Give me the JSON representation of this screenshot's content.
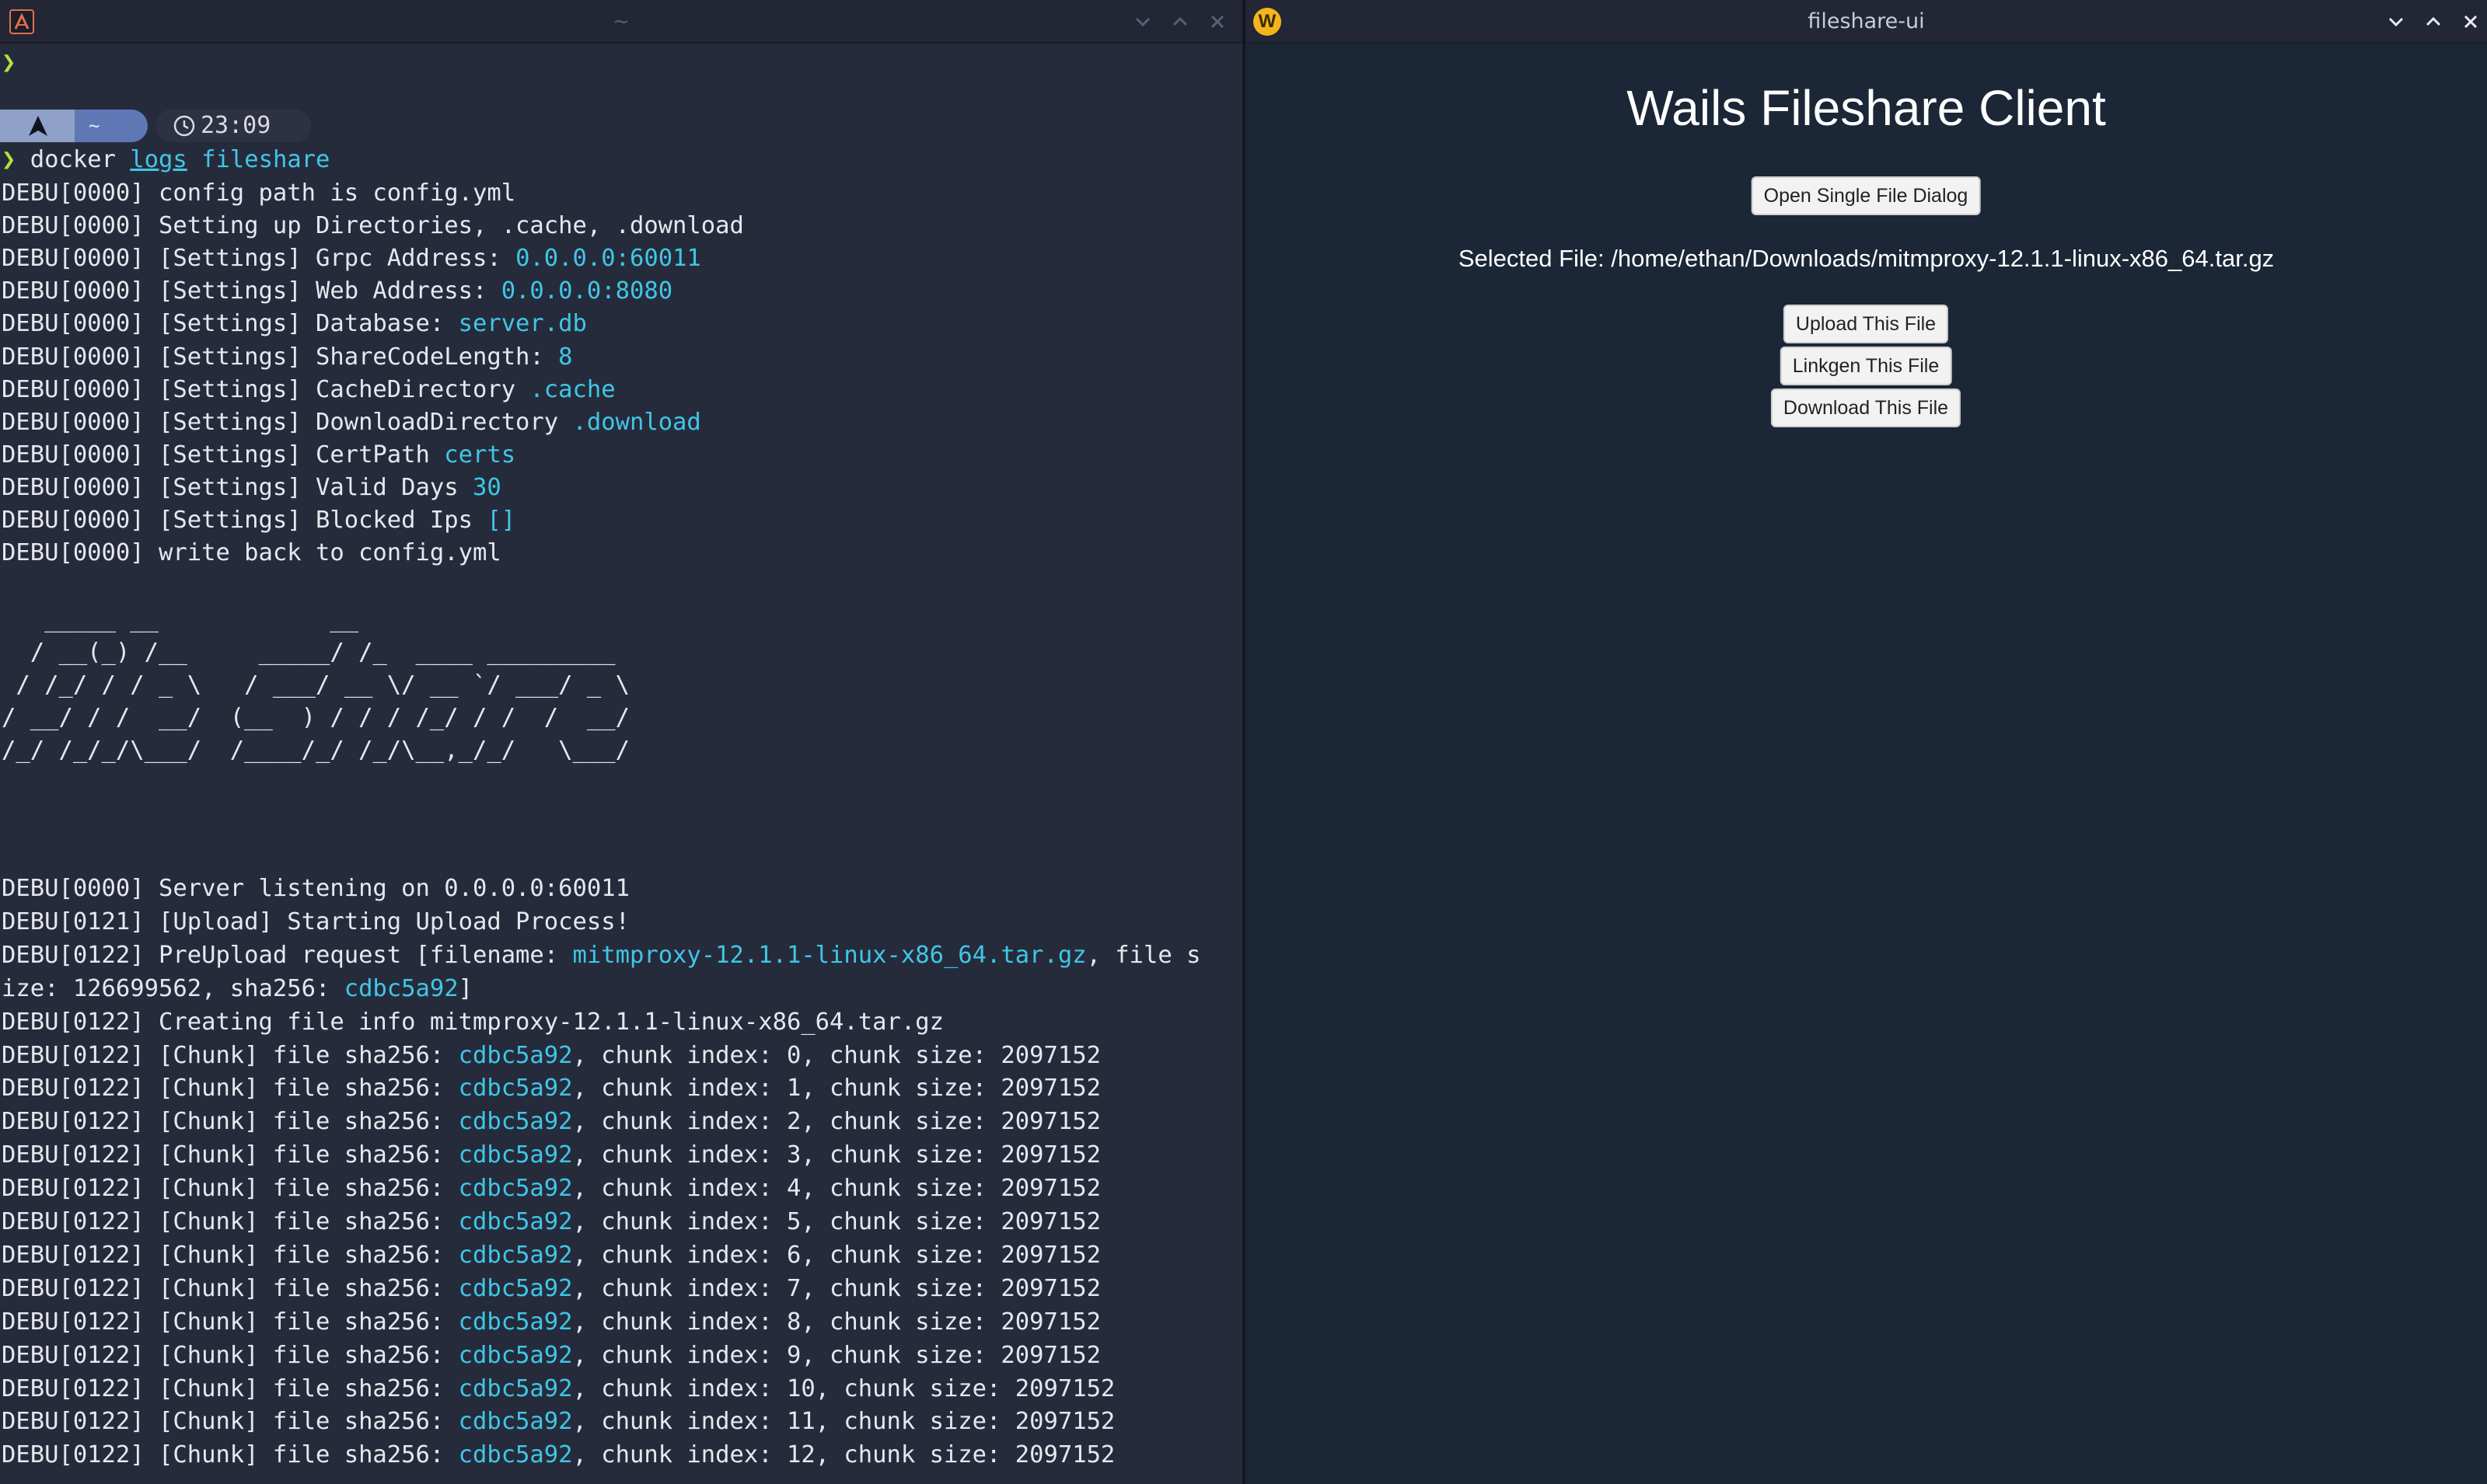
{
  "terminal": {
    "window_title": "~",
    "prompt_symbol": "❯",
    "prompt_dir": "~",
    "prompt_time": "23:09",
    "command": {
      "cmd": "docker",
      "arg1": "logs",
      "arg2": "fileshare"
    },
    "lines_top": [
      [
        "DEBU[0000] config path is config.yml"
      ],
      [
        "DEBU[0000] Setting up Directories, .cache, .download"
      ],
      [
        "DEBU[0000] [Settings] Grpc Address: ",
        "0.0.0.0:60011"
      ],
      [
        "DEBU[0000] [Settings] Web Address: ",
        "0.0.0.0:8080"
      ],
      [
        "DEBU[0000] [Settings] Database: ",
        "server.db"
      ],
      [
        "DEBU[0000] [Settings] ShareCodeLength: ",
        "8"
      ],
      [
        "DEBU[0000] [Settings] CacheDirectory ",
        ".cache"
      ],
      [
        "DEBU[0000] [Settings] DownloadDirectory ",
        ".download"
      ],
      [
        "DEBU[0000] [Settings] CertPath ",
        "certs"
      ],
      [
        "DEBU[0000] [Settings] Valid Days ",
        "30"
      ],
      [
        "DEBU[0000] [Settings] Blocked Ips ",
        "[]"
      ],
      [
        "DEBU[0000] write back to config.yml"
      ]
    ],
    "ascii_art": [
      "   _____ __            __",
      "  / __(_) /__     _____/ /_  ____ _________",
      " / /_/ / / _ \\   / ___/ __ \\/ __ `/ ___/ _ \\",
      "/ __/ / /  __/  (__  ) / / / /_/ / /  /  __/",
      "/_/ /_/_/\\___/  /____/_/ /_/\\__,_/_/   \\___/"
    ],
    "lines_bottom": [
      [
        "DEBU[0000] Server listening on 0.0.0.0:60011"
      ],
      [
        "DEBU[0121] [Upload] Starting Upload Process!"
      ],
      [
        "DEBU[0122] PreUpload request [filename: ",
        "mitmproxy-12.1.1-linux-x86_64.tar.gz",
        ", file s"
      ],
      [
        "ize: 126699562, sha256: ",
        "cdbc5a92",
        "]"
      ],
      [
        "DEBU[0122] Creating file info mitmproxy-12.1.1-linux-x86_64.tar.gz"
      ],
      [
        "DEBU[0122] [Chunk] file sha256: ",
        "cdbc5a92",
        ", chunk index: 0, chunk size: 2097152"
      ],
      [
        "DEBU[0122] [Chunk] file sha256: ",
        "cdbc5a92",
        ", chunk index: 1, chunk size: 2097152"
      ],
      [
        "DEBU[0122] [Chunk] file sha256: ",
        "cdbc5a92",
        ", chunk index: 2, chunk size: 2097152"
      ],
      [
        "DEBU[0122] [Chunk] file sha256: ",
        "cdbc5a92",
        ", chunk index: 3, chunk size: 2097152"
      ],
      [
        "DEBU[0122] [Chunk] file sha256: ",
        "cdbc5a92",
        ", chunk index: 4, chunk size: 2097152"
      ],
      [
        "DEBU[0122] [Chunk] file sha256: ",
        "cdbc5a92",
        ", chunk index: 5, chunk size: 2097152"
      ],
      [
        "DEBU[0122] [Chunk] file sha256: ",
        "cdbc5a92",
        ", chunk index: 6, chunk size: 2097152"
      ],
      [
        "DEBU[0122] [Chunk] file sha256: ",
        "cdbc5a92",
        ", chunk index: 7, chunk size: 2097152"
      ],
      [
        "DEBU[0122] [Chunk] file sha256: ",
        "cdbc5a92",
        ", chunk index: 8, chunk size: 2097152"
      ],
      [
        "DEBU[0122] [Chunk] file sha256: ",
        "cdbc5a92",
        ", chunk index: 9, chunk size: 2097152"
      ],
      [
        "DEBU[0122] [Chunk] file sha256: ",
        "cdbc5a92",
        ", chunk index: 10, chunk size: 2097152"
      ],
      [
        "DEBU[0122] [Chunk] file sha256: ",
        "cdbc5a92",
        ", chunk index: 11, chunk size: 2097152"
      ],
      [
        "DEBU[0122] [Chunk] file sha256: ",
        "cdbc5a92",
        ", chunk index: 12, chunk size: 2097152"
      ]
    ]
  },
  "app": {
    "window_title": "fileshare-ui",
    "logo_letter": "W",
    "heading": "Wails Fileshare Client",
    "open_dialog_label": "Open Single File Dialog",
    "selected_file_label": "Selected File: /home/ethan/Downloads/mitmproxy-12.1.1-linux-x86_64.tar.gz",
    "upload_label": "Upload This File",
    "linkgen_label": "Linkgen This File",
    "download_label": "Download This File"
  },
  "colors": {
    "terminal_bg": "#262b3c",
    "app_bg": "#1b2636",
    "accent_cyan": "#3fc7e6",
    "prompt_green": "#b2e23a"
  }
}
